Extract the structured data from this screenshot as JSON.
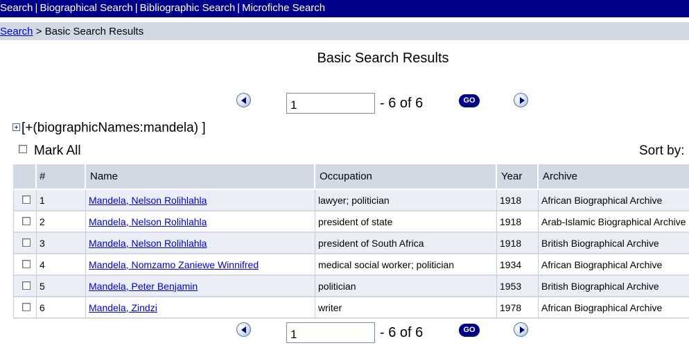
{
  "topnav": {
    "items": [
      "Search",
      "Biographical Search",
      "Bibliographic Search",
      "Microfiche Search"
    ],
    "separator": "|"
  },
  "breadcrumb": {
    "link": "Search",
    "separator": ">",
    "current": "Basic Search Results"
  },
  "title": "Basic Search Results",
  "pager": {
    "page_value": "1",
    "count_text": "- 6 of 6",
    "go_label": "GO"
  },
  "query": "[+(biographicNames:mandela) ]",
  "mark_all_label": "Mark All",
  "sort_by_label": "Sort by:",
  "table": {
    "headers": [
      "#",
      "Name",
      "Occupation",
      "Year",
      "Archive"
    ],
    "rows": [
      {
        "num": "1",
        "name": "Mandela, Nelson Rolihlahla",
        "occupation": "lawyer; politician",
        "year": "1918",
        "archive": "African Biographical Archive"
      },
      {
        "num": "2",
        "name": "Mandela, Nelson Rolihlahla",
        "occupation": "president of state",
        "year": "1918",
        "archive": "Arab-Islamic Biographical Archive"
      },
      {
        "num": "3",
        "name": "Mandela, Nelson Rolihlahla",
        "occupation": "president of South Africa",
        "year": "1918",
        "archive": "British Biographical Archive"
      },
      {
        "num": "4",
        "name": "Mandela, Nomzamo Zaniewe Winnifred",
        "occupation": "medical social worker; politician",
        "year": "1934",
        "archive": "African Biographical Archive"
      },
      {
        "num": "5",
        "name": "Mandela, Peter Benjamin",
        "occupation": "politician",
        "year": "1953",
        "archive": "British Biographical Archive"
      },
      {
        "num": "6",
        "name": "Mandela, Zindzi",
        "occupation": "writer",
        "year": "1978",
        "archive": "African Biographical Archive"
      }
    ]
  },
  "colors": {
    "nav_bg": "#00008b",
    "header_bg": "#d2d9e5",
    "row_alt": "#eceef7",
    "link": "#0000cc"
  },
  "icons": [
    "previous-page-icon",
    "next-page-icon",
    "expand-plus-icon",
    "go-button-icon"
  ]
}
